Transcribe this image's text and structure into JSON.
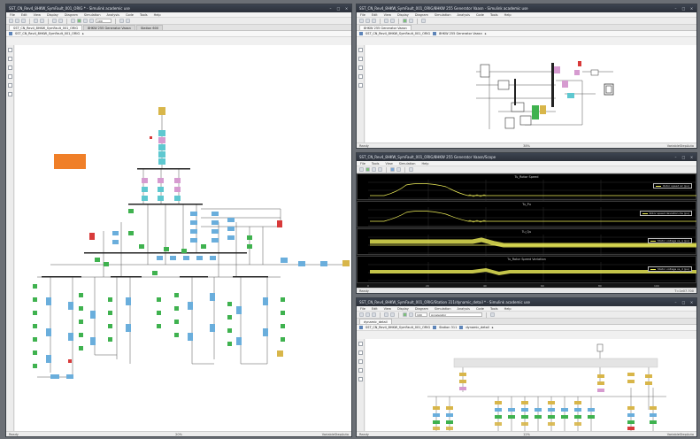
{
  "menu_items": [
    "File",
    "Edit",
    "View",
    "Display",
    "Diagram",
    "Simulation",
    "Analysis",
    "Code",
    "Tools",
    "Help"
  ],
  "left_window": {
    "title": "SST_CN_Rev4_8HKW_SymFault_001_ORIG * - Simulink academic use",
    "tabs": [
      "SST_CN_Rev4_8HKW_SymFault_001_ORIG",
      "8HKW 255 Generator Vaasn",
      "Station 600"
    ],
    "path": [
      "SST_CN_Rev4_8HKW_SymFault_001_ORIG",
      "▸"
    ],
    "status": {
      "left": "Ready",
      "zoom": "20%",
      "right": "VariableStepAuto"
    },
    "sim_time": "100"
  },
  "top_right_window": {
    "title": "SST_CN_Rev4_8HKW_SymFault_001_ORIG/8HKW 255 Generator Vaasn - Simulink academic use",
    "tabs": [
      "8HKW 255 Generator Vaasn"
    ],
    "path": [
      "SST_CN_Rev4_8HKW_SymFault_001_ORIG",
      "8HKW 255 Generator Vaasn",
      "▸"
    ],
    "status": {
      "left": "Ready",
      "zoom": "38%",
      "right": "VariableStepAuto"
    }
  },
  "scope_window": {
    "title": "SST_CN_Rev4_8HKW_SymFault_001_ORIG/8HKW 255 Generator Vaasn/Scope",
    "menu": [
      "File",
      "Tools",
      "View",
      "Simulation",
      "Help"
    ],
    "panels": [
      {
        "title": "Tu_Rotor Speed",
        "legend": "Rotor speed wr (pu)"
      },
      {
        "title": "Tu_Pu",
        "legend": "Rotor speed deviation dw (pu)"
      },
      {
        "title": "Tu_Qu",
        "legend": "Stator voltage vs_q (pu)"
      },
      {
        "title": "Tu_Rotor Speed Variation",
        "legend": "Stator voltage vs_d (pu)"
      }
    ],
    "x_ticks": [
      "0",
      "20",
      "40",
      "60",
      "80",
      "100"
    ],
    "status": {
      "left": "Ready",
      "right": "T=1e07.700"
    }
  },
  "bottom_right_window": {
    "title": "SST_CN_Rev4_8HKW_SymFault_001_ORIG/Station 311/dynamic_detail * - Simulink academic use",
    "tabs": [
      "dynamic_detail"
    ],
    "path": [
      "SST_CN_Rev4_8HKW_SymFault_001_ORIG",
      "Station 311",
      "dynamic_detail",
      "▸"
    ],
    "status": {
      "left": "Ready",
      "zoom": "12%",
      "right": "VariableStepAuto"
    },
    "sim_time": "100",
    "sim_mode": "Accelerator"
  },
  "colors": {
    "accent_orange": "#f07f28",
    "block_blue": "#6aaedc",
    "block_green": "#3fb24f",
    "block_pink": "#d69bd0",
    "block_cyan": "#5ec8d0",
    "block_yellow": "#d8b64a",
    "block_red": "#d83a3a",
    "scope_trace": "#f2f25a"
  }
}
